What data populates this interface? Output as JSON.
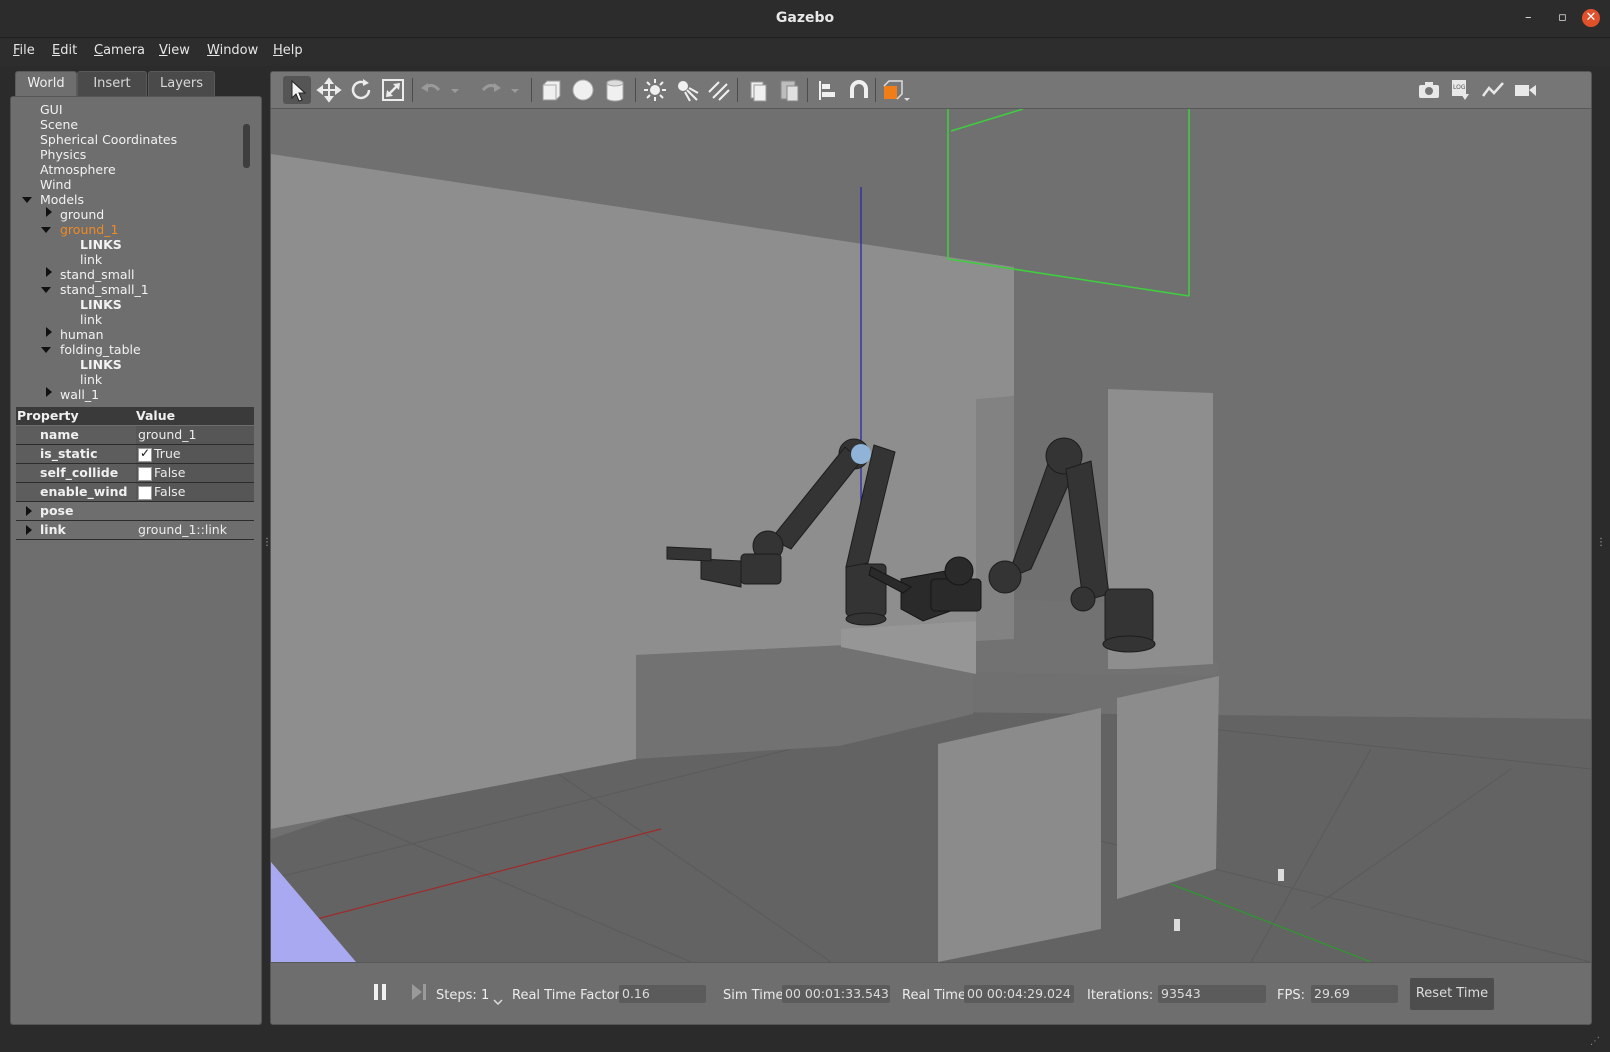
{
  "window": {
    "title": "Gazebo",
    "minimize": "–",
    "maximize": "▫",
    "close": "✕"
  },
  "menu": [
    "File",
    "Edit",
    "Camera",
    "View",
    "Window",
    "Help"
  ],
  "tabs": [
    "World",
    "Insert",
    "Layers"
  ],
  "tree": [
    {
      "label": "GUI",
      "indent": 0
    },
    {
      "label": "Scene",
      "indent": 0
    },
    {
      "label": "Spherical Coordinates",
      "indent": 0
    },
    {
      "label": "Physics",
      "indent": 0
    },
    {
      "label": "Atmosphere",
      "indent": 0
    },
    {
      "label": "Wind",
      "indent": 0
    },
    {
      "label": "Models",
      "indent": 0,
      "expander": "open"
    },
    {
      "label": "ground",
      "indent": 1,
      "expander": "closed"
    },
    {
      "label": "ground_1",
      "indent": 1,
      "expander": "open",
      "selected": true
    },
    {
      "label": "LINKS",
      "indent": 2,
      "bold": true
    },
    {
      "label": "link",
      "indent": 2
    },
    {
      "label": "stand_small",
      "indent": 1,
      "expander": "closed"
    },
    {
      "label": "stand_small_1",
      "indent": 1,
      "expander": "open"
    },
    {
      "label": "LINKS",
      "indent": 2,
      "bold": true
    },
    {
      "label": "link",
      "indent": 2
    },
    {
      "label": "human",
      "indent": 1,
      "expander": "closed"
    },
    {
      "label": "folding_table",
      "indent": 1,
      "expander": "open"
    },
    {
      "label": "LINKS",
      "indent": 2,
      "bold": true
    },
    {
      "label": "link",
      "indent": 2
    },
    {
      "label": "wall_1",
      "indent": 1,
      "expander": "closed"
    }
  ],
  "properties": {
    "header": {
      "property": "Property",
      "value": "Value"
    },
    "rows": [
      {
        "key": "name",
        "value": "ground_1",
        "type": "text"
      },
      {
        "key": "is_static",
        "value": "True",
        "type": "check",
        "checked": true
      },
      {
        "key": "self_collide",
        "value": "False",
        "type": "check",
        "checked": false
      },
      {
        "key": "enable_wind",
        "value": "False",
        "type": "check",
        "checked": false
      },
      {
        "key": "pose",
        "value": "",
        "type": "group"
      },
      {
        "key": "link",
        "value": "ground_1::link",
        "type": "group"
      }
    ]
  },
  "toolbar": {
    "left": [
      "select-mode-icon",
      "translate-mode-icon",
      "rotate-mode-icon",
      "scale-mode-icon",
      "undo-icon",
      "undo-history-icon",
      "redo-icon",
      "redo-history-icon",
      "box-shape-icon",
      "sphere-shape-icon",
      "cylinder-shape-icon",
      "point-light-icon",
      "spot-light-icon",
      "directional-light-icon",
      "copy-icon",
      "paste-icon",
      "align-icon",
      "snap-icon",
      "view-angle-icon"
    ],
    "right": [
      "screenshot-icon",
      "log-icon",
      "plot-icon",
      "record-video-icon"
    ]
  },
  "status": {
    "steps_label": "Steps:",
    "steps_value": "1",
    "rtf_label": "Real Time Factor:",
    "rtf_value": "0.16",
    "sim_time_label": "Sim Time:",
    "sim_time_value": "00 00:01:33.543",
    "real_time_label": "Real Time:",
    "real_time_value": "00 00:04:29.024",
    "iterations_label": "Iterations:",
    "iterations_value": "93543",
    "fps_label": "FPS:",
    "fps_value": "29.69",
    "reset_label": "Reset Time"
  },
  "colors": {
    "selection": "#f08a24",
    "accent_orange": "#f07d18",
    "x_axis": "#b03030",
    "y_axis": "#2fa02f",
    "z_axis": "#2626a8",
    "close_button": "#e0512b"
  }
}
